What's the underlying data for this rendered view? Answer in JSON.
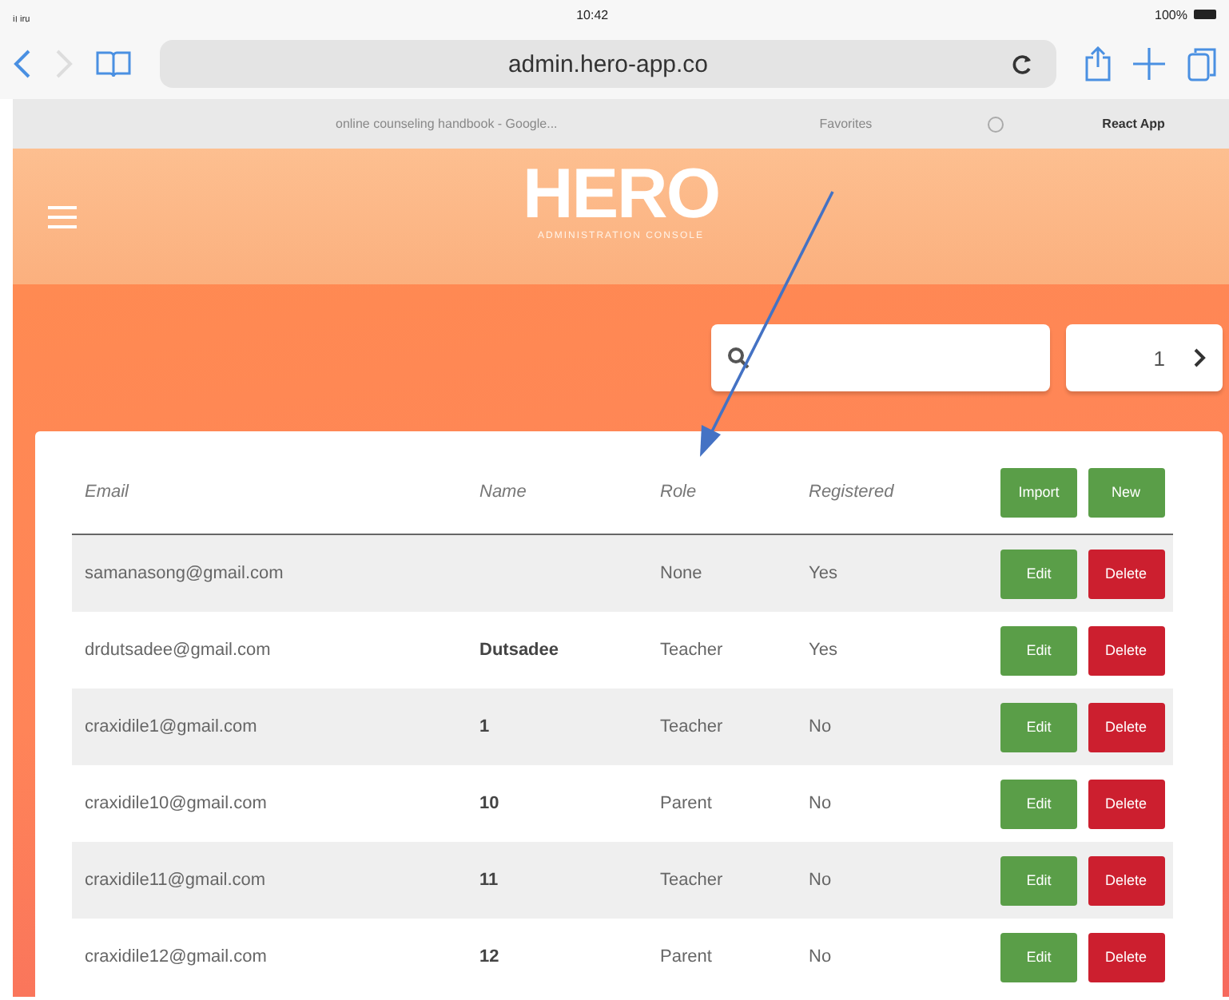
{
  "status_bar": {
    "carrier": "ᵢₗ ᵢᵣᵤ",
    "time": "10:42",
    "battery": "100%"
  },
  "browser": {
    "address": "admin.hero-app.co",
    "bookmarks": [
      {
        "label": "online counseling handbook - Google..."
      },
      {
        "label": "Favorites"
      },
      {
        "label": "React App"
      }
    ]
  },
  "header": {
    "logo": "HERO",
    "subtitle": "ADMINISTRATION CONSOLE"
  },
  "pager": {
    "page": "1"
  },
  "table": {
    "columns": [
      "Email",
      "Name",
      "Role",
      "Registered"
    ],
    "header_buttons": [
      "Import",
      "New"
    ],
    "rows": [
      {
        "email": "samanasong@gmail.com",
        "name": "",
        "role": "None",
        "registered": "Yes",
        "actions": [
          "Edit",
          "Delete"
        ]
      },
      {
        "email": "drdutsadee@gmail.com",
        "name": "Dutsadee",
        "role": "Teacher",
        "registered": "Yes",
        "actions": [
          "Edit",
          "Delete"
        ]
      },
      {
        "email": "craxidile1@gmail.com",
        "name": "1",
        "role": "Teacher",
        "registered": "No",
        "actions": [
          "Edit",
          "Delete"
        ]
      },
      {
        "email": "craxidile10@gmail.com",
        "name": "10",
        "role": "Parent",
        "registered": "No",
        "actions": [
          "Edit",
          "Delete"
        ]
      },
      {
        "email": "craxidile11@gmail.com",
        "name": "11",
        "role": "Teacher",
        "registered": "No",
        "actions": [
          "Edit",
          "Delete"
        ]
      },
      {
        "email": "craxidile12@gmail.com",
        "name": "12",
        "role": "Parent",
        "registered": "No",
        "actions": [
          "Edit",
          "Delete"
        ]
      }
    ]
  }
}
